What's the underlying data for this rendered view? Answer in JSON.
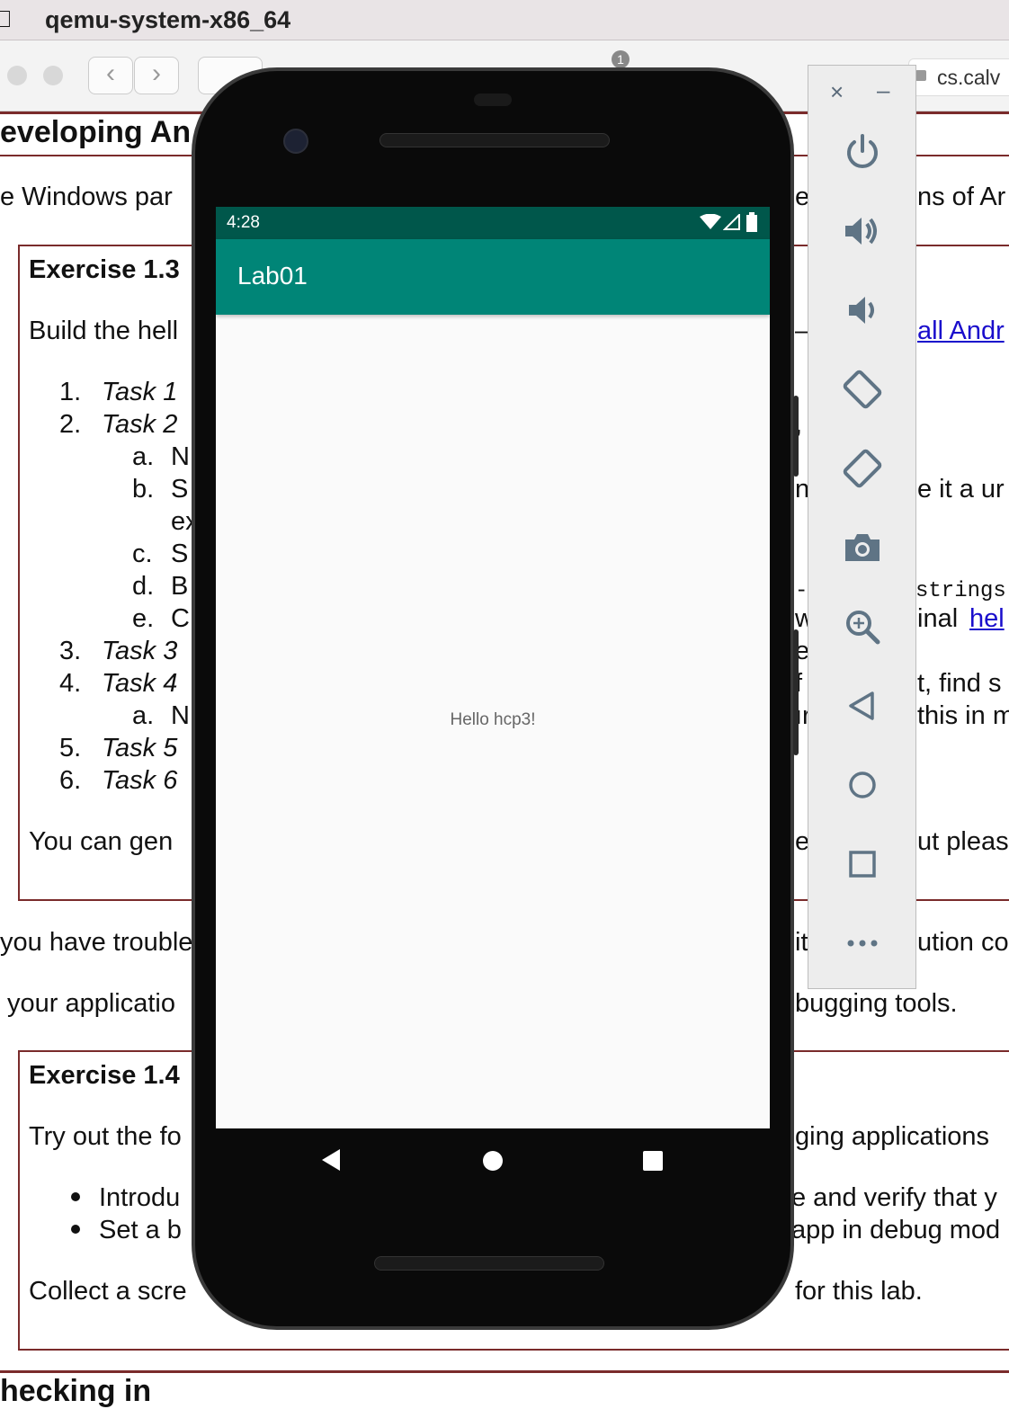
{
  "window": {
    "app_title": "qemu-system-x86_64"
  },
  "browser": {
    "url": "cs.calv",
    "tab_badge": "1"
  },
  "webpage": {
    "heading_top": "eveloping An",
    "intro_left": "e Windows par",
    "intro_mid": "e",
    "intro_right": "ns of Ar",
    "exercise1": {
      "title": "Exercise 1.3",
      "desc_left": "Build the hell",
      "desc_mid": "–",
      "desc_link": "all Andr",
      "tasks": [
        {
          "num": "1.",
          "label": "Task 1"
        },
        {
          "num": "2.",
          "label": "Task 2"
        },
        {
          "num": "3.",
          "label": "Task 3"
        },
        {
          "num": "4.",
          "label": "Task 4"
        },
        {
          "num": "5.",
          "label": "Task 5"
        },
        {
          "num": "6.",
          "label": "Task 6"
        }
      ],
      "subtasks": [
        {
          "letter": "a.",
          "text": "N"
        },
        {
          "letter": "b.",
          "text": "S"
        },
        {
          "letter": "",
          "text": "ex"
        },
        {
          "letter": "c.",
          "text": "S"
        },
        {
          "letter": "d.",
          "text": "B"
        },
        {
          "letter": "e.",
          "text": "C"
        }
      ],
      "subtask4a": {
        "letter": "a.",
        "text": "N"
      },
      "right_fragments": {
        "comma": ",",
        "b_mid": "n",
        "b_right": "e it a ur",
        "d_mid": "-/",
        "d_right": "strings",
        "e_mid": "w",
        "e_right": "inal",
        "e_link": "hel",
        "t3_mid": "e",
        "t4_mid": "f",
        "t4_right": "t, find s",
        "t4a_mid": "ır",
        "t4a_right": "this in m"
      },
      "generate_left": "You can gen",
      "generate_mid": "e",
      "generate_right": "ut pleas"
    },
    "trouble_left": "you have trouble",
    "trouble_mid": "it",
    "trouble_right": "ution co",
    "app_left": "your applicatio",
    "app_right": "bugging tools.",
    "exercise2": {
      "title": "Exercise 1.4",
      "desc_left": "Try out the fo",
      "desc_right": "ging applications",
      "bullets": [
        {
          "left": "Introdu",
          "right": "e and verify that y"
        },
        {
          "left": "Set a b",
          "right": "app in debug mod"
        }
      ],
      "collect_left": "Collect a scre",
      "collect_right": "for this lab."
    },
    "heading_bottom": "hecking in"
  },
  "emulator": {
    "status_time": "4:28",
    "app_title": "Lab01",
    "content_text": "Hello hcp3!",
    "colors": {
      "primary": "#008577",
      "primary_dark": "#00574b"
    }
  },
  "emulator_toolbar": {
    "buttons": [
      "close-icon",
      "minimize-icon",
      "power-icon",
      "volume-up-icon",
      "volume-down-icon",
      "rotate-left-icon",
      "rotate-right-icon",
      "camera-icon",
      "zoom-icon",
      "back-icon",
      "home-icon",
      "overview-icon",
      "more-icon"
    ]
  }
}
